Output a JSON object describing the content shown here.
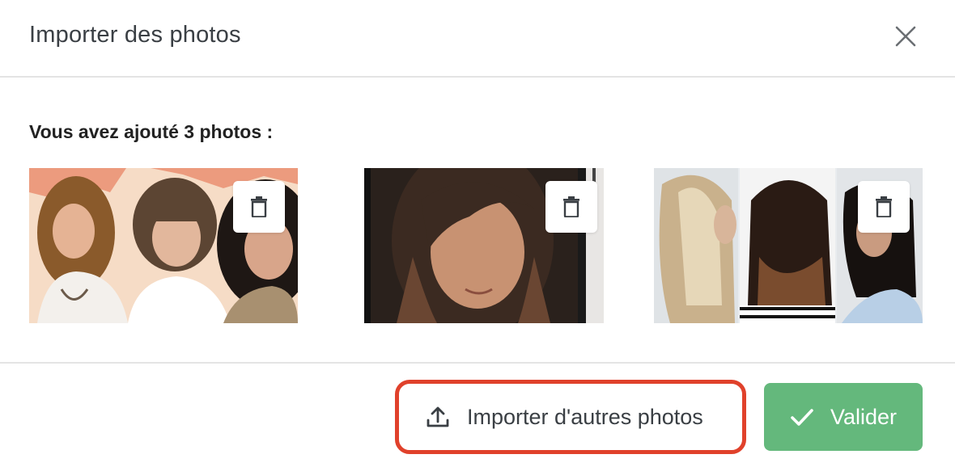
{
  "dialog": {
    "title": "Importer des photos",
    "close_icon": "close-icon"
  },
  "content": {
    "subtitle": "Vous avez ajouté 3 photos :",
    "photos": [
      {
        "alt": "Three women with wavy hairstyles",
        "delete_icon": "trash-icon"
      },
      {
        "alt": "Woman with long brown straight hair",
        "delete_icon": "trash-icon"
      },
      {
        "alt": "Collage of long layered and half-up hairstyles",
        "delete_icon": "trash-icon"
      }
    ]
  },
  "footer": {
    "import_more_label": "Importer d'autres photos",
    "import_icon": "upload-icon",
    "validate_label": "Valider",
    "validate_icon": "check-icon"
  },
  "colors": {
    "highlight_border": "#e0412b",
    "validate_bg": "#64b87c",
    "divider": "#e4e4e4"
  }
}
